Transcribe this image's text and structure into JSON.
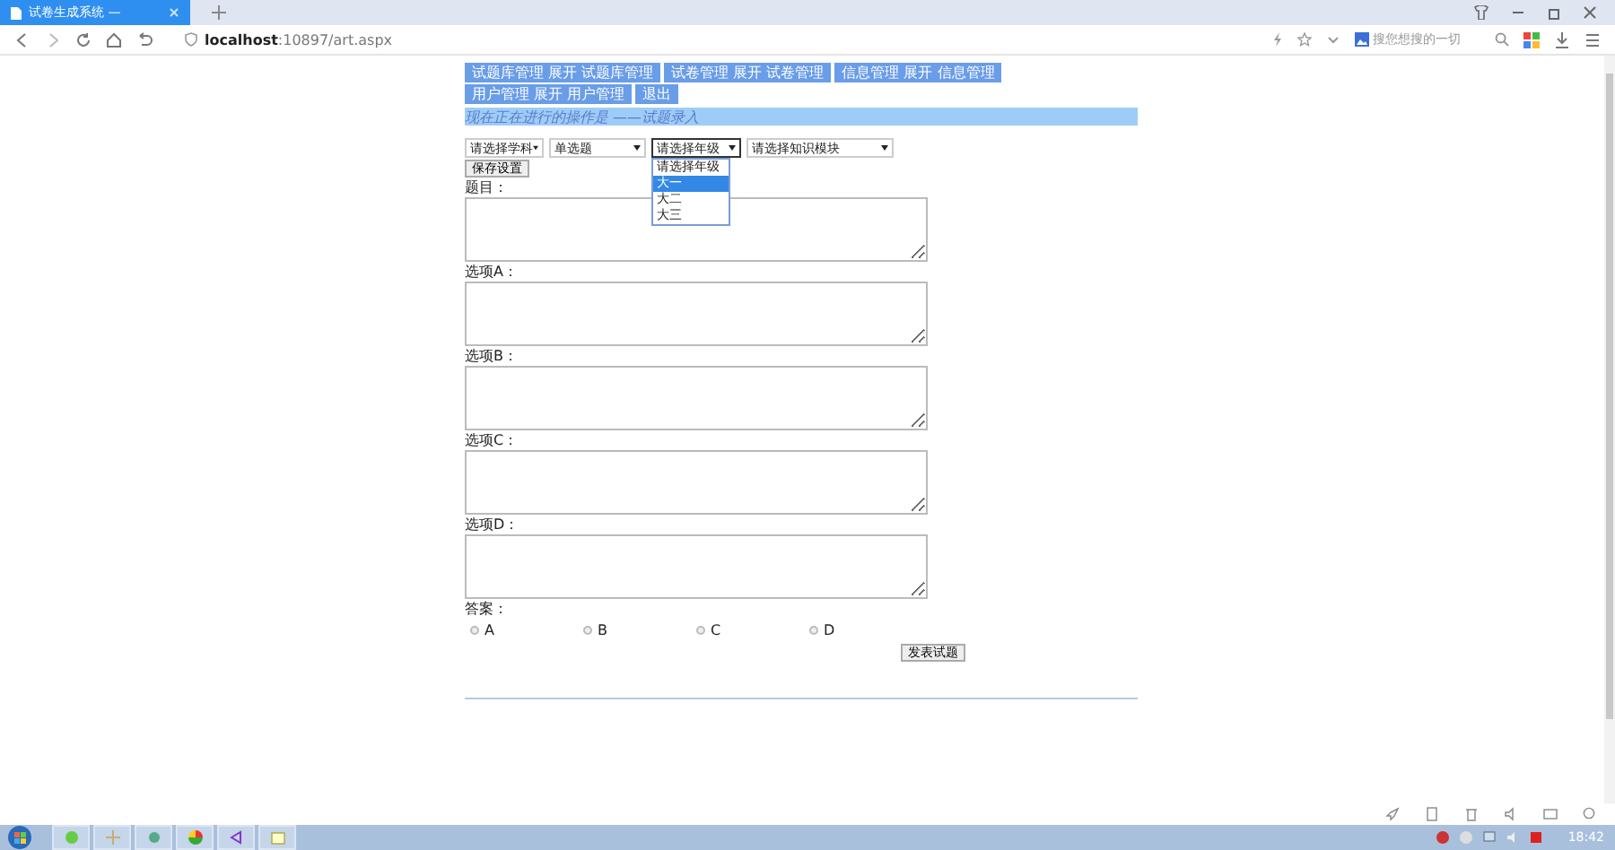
{
  "browser": {
    "tab_title": "试卷生成系统 —",
    "url_host": "localhost",
    "url_rest": ":10897/art.aspx",
    "search_placeholder": "搜您想搜的一切",
    "clock": "18:42"
  },
  "nav_menu": [
    {
      "label": "试题库管理 展开 试题库管理"
    },
    {
      "label": "试卷管理 展开 试卷管理"
    },
    {
      "label": "信息管理 展开 信息管理"
    },
    {
      "label": "用户管理 展开 用户管理"
    },
    {
      "label": "退出"
    }
  ],
  "status_text": "现在正在进行的操作是 ——试题录入",
  "selects": [
    {
      "value": "请选择学科",
      "open": false
    },
    {
      "value": "单选题",
      "open": false
    },
    {
      "value": "请选择年级",
      "open": true
    },
    {
      "value": "请选择知识模块",
      "open": false
    }
  ],
  "dropdown_options": [
    {
      "label": "请选择年级",
      "selected": false
    },
    {
      "label": "大一",
      "selected": true
    },
    {
      "label": "大二",
      "selected": false
    },
    {
      "label": "大三",
      "selected": false
    }
  ],
  "save_button": "保存设置",
  "fields": [
    {
      "label": "题目："
    },
    {
      "label": "选项A："
    },
    {
      "label": "选项B："
    },
    {
      "label": "选项C："
    },
    {
      "label": "选项D："
    }
  ],
  "answer": {
    "label": "答案：",
    "options": [
      {
        "label": "A",
        "selected": false
      },
      {
        "label": "B",
        "selected": false
      },
      {
        "label": "C",
        "selected": false
      },
      {
        "label": "D",
        "selected": false
      }
    ]
  },
  "submit_button": "发表试题"
}
